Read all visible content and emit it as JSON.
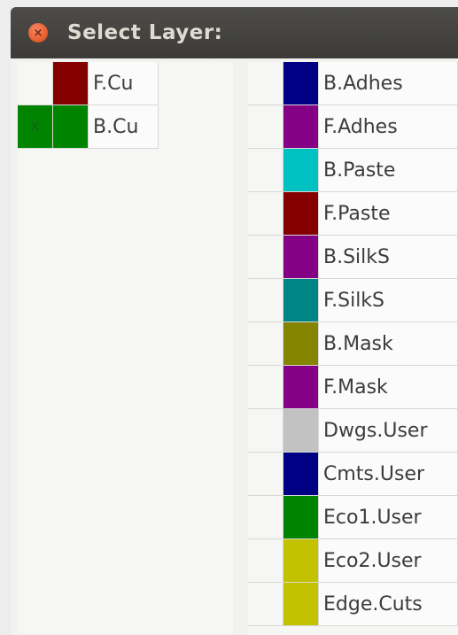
{
  "window": {
    "title": "Select Layer:",
    "close_glyph": "×"
  },
  "left_layers": [
    {
      "name": "F.Cu",
      "color": "#840000",
      "selected": false,
      "mark": "",
      "sel_bg": "#f6f6f5"
    },
    {
      "name": "B.Cu",
      "color": "#008400",
      "selected": true,
      "mark": "X",
      "sel_bg": "#008400"
    }
  ],
  "right_layers": [
    {
      "name": "B.Adhes",
      "color": "#000084"
    },
    {
      "name": "F.Adhes",
      "color": "#840084"
    },
    {
      "name": "B.Paste",
      "color": "#00c2c2"
    },
    {
      "name": "F.Paste",
      "color": "#840000"
    },
    {
      "name": "B.SilkS",
      "color": "#840084"
    },
    {
      "name": "F.SilkS",
      "color": "#008484"
    },
    {
      "name": "B.Mask",
      "color": "#848400"
    },
    {
      "name": "F.Mask",
      "color": "#840084"
    },
    {
      "name": "Dwgs.User",
      "color": "#c2c2c2"
    },
    {
      "name": "Cmts.User",
      "color": "#000084"
    },
    {
      "name": "Eco1.User",
      "color": "#008400"
    },
    {
      "name": "Eco2.User",
      "color": "#c2c200"
    },
    {
      "name": "Edge.Cuts",
      "color": "#c2c200"
    }
  ]
}
